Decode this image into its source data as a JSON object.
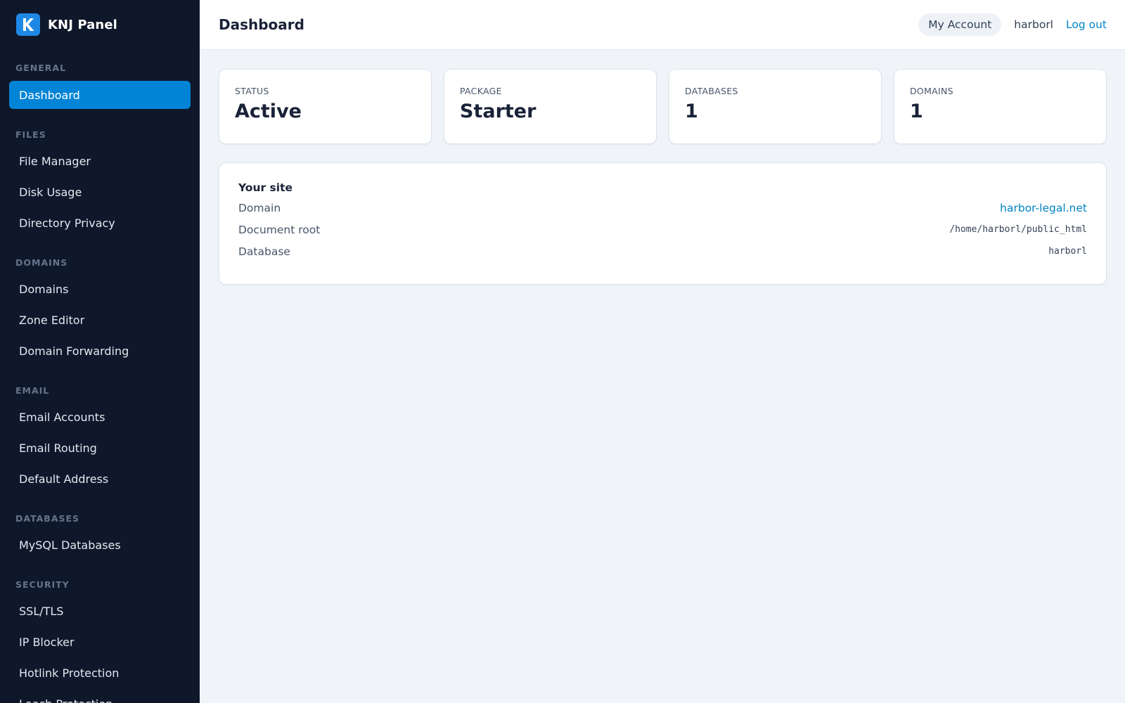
{
  "brand": {
    "logo_letter": "K",
    "title": "KNJ Panel",
    "logo_color": "#1e88e5"
  },
  "sidebar": {
    "sections": [
      {
        "title": "GENERAL",
        "items": [
          {
            "label": "Dashboard",
            "active": true
          }
        ]
      },
      {
        "title": "FILES",
        "items": [
          {
            "label": "File Manager"
          },
          {
            "label": "Disk Usage"
          },
          {
            "label": "Directory Privacy"
          }
        ]
      },
      {
        "title": "DOMAINS",
        "items": [
          {
            "label": "Domains"
          },
          {
            "label": "Zone Editor"
          },
          {
            "label": "Domain Forwarding"
          }
        ]
      },
      {
        "title": "EMAIL",
        "items": [
          {
            "label": "Email Accounts"
          },
          {
            "label": "Email Routing"
          },
          {
            "label": "Default Address"
          }
        ]
      },
      {
        "title": "DATABASES",
        "items": [
          {
            "label": "MySQL Databases"
          }
        ]
      },
      {
        "title": "SECURITY",
        "items": [
          {
            "label": "SSL/TLS"
          },
          {
            "label": "IP Blocker"
          },
          {
            "label": "Hotlink Protection"
          },
          {
            "label": "Leech Protection"
          }
        ]
      }
    ]
  },
  "header": {
    "title": "Dashboard",
    "account_label": "My Account",
    "username": "harborl",
    "logout_label": "Log out"
  },
  "stats": {
    "status": {
      "label": "STATUS",
      "value": "Active"
    },
    "package": {
      "label": "PACKAGE",
      "value": "Starter"
    },
    "databases": {
      "label": "DATABASES",
      "value": "1"
    },
    "domains": {
      "label": "DOMAINS",
      "value": "1"
    }
  },
  "site": {
    "title": "Your site",
    "domain_label": "Domain",
    "domain_value": "harbor-legal.net",
    "docroot_label": "Document root",
    "docroot_value": "/home/harborl/public_html",
    "database_label": "Database",
    "database_value": "harborl"
  },
  "colors": {
    "sidebar_bg": "#0f172a",
    "active_item": "#0284d6",
    "link": "#0284c7",
    "content_bg": "#f0f4f9"
  }
}
